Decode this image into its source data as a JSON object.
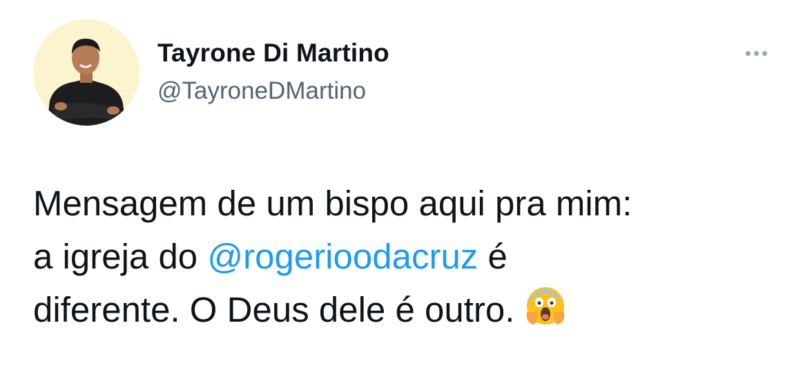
{
  "tweet": {
    "author_name": "Tayrone Di Martino",
    "author_handle": "@TayroneDMartino",
    "more_icon": "ellipsis-icon",
    "text_line1": "Mensagem de um bispo aqui pra mim:",
    "text_line2_before": "a igreja do ",
    "mention": "@rogerioodacruz",
    "text_line2_after": " é",
    "text_line3": "diferente. O Deus dele é outro.",
    "emoji": "face-screaming-in-fear-emoji",
    "colors": {
      "text": "#0f1419",
      "handle": "#536471",
      "link": "#1d9bf0",
      "avatar_bg": "#fbf4cf"
    }
  }
}
